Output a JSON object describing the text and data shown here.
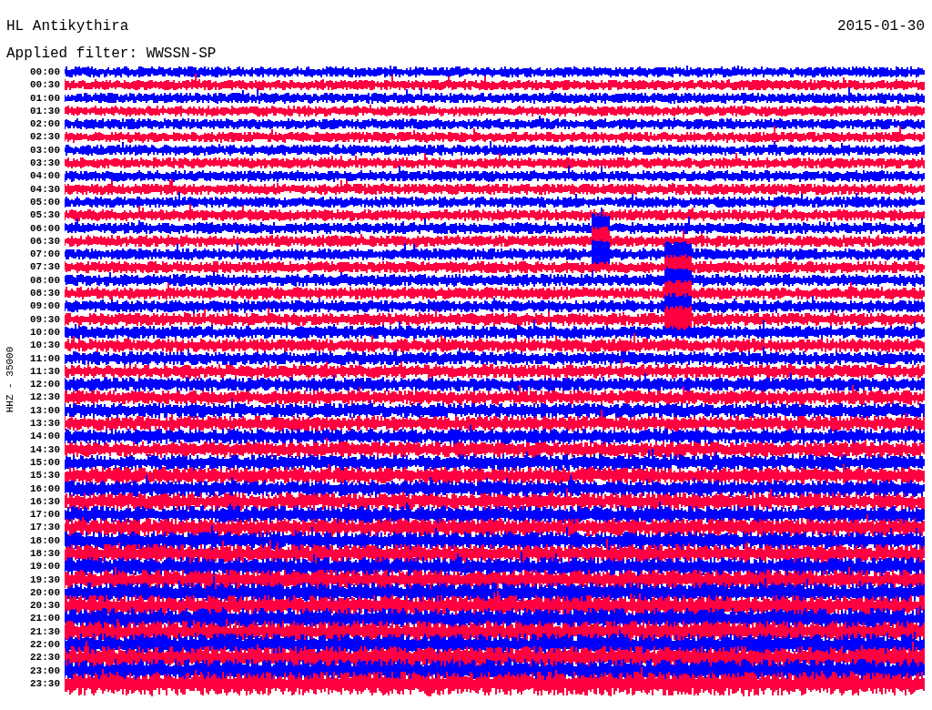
{
  "header": {
    "station": "HL Antikythira",
    "date": "2015-01-30",
    "filter": "Applied filter: WWSSN-SP"
  },
  "axis_label": "HHZ - 35000",
  "rows": [
    {
      "time": "00:00",
      "color": "#0000ff"
    },
    {
      "time": "00:30",
      "color": "#ff0040"
    },
    {
      "time": "01:00",
      "color": "#0000ff"
    },
    {
      "time": "01:30",
      "color": "#ff0040"
    },
    {
      "time": "02:00",
      "color": "#0000ff"
    },
    {
      "time": "02:30",
      "color": "#ff0040"
    },
    {
      "time": "03:00",
      "color": "#0000ff"
    },
    {
      "time": "03:30",
      "color": "#ff0040"
    },
    {
      "time": "04:00",
      "color": "#0000ff"
    },
    {
      "time": "04:30",
      "color": "#ff0040"
    },
    {
      "time": "05:00",
      "color": "#0000ff"
    },
    {
      "time": "05:30",
      "color": "#ff0040"
    },
    {
      "time": "06:00",
      "color": "#0000ff"
    },
    {
      "time": "06:30",
      "color": "#ff0040"
    },
    {
      "time": "07:00",
      "color": "#0000ff"
    },
    {
      "time": "07:30",
      "color": "#ff0040"
    },
    {
      "time": "08:00",
      "color": "#0000ff"
    },
    {
      "time": "08:30",
      "color": "#ff0040"
    },
    {
      "time": "09:00",
      "color": "#0000ff"
    },
    {
      "time": "09:30",
      "color": "#ff0040"
    },
    {
      "time": "10:00",
      "color": "#0000ff"
    },
    {
      "time": "10:30",
      "color": "#ff0040"
    },
    {
      "time": "11:00",
      "color": "#0000ff"
    },
    {
      "time": "11:30",
      "color": "#ff0040"
    },
    {
      "time": "12:00",
      "color": "#0000ff"
    },
    {
      "time": "12:30",
      "color": "#ff0040"
    },
    {
      "time": "13:00",
      "color": "#0000ff"
    },
    {
      "time": "13:30",
      "color": "#ff0040"
    },
    {
      "time": "14:00",
      "color": "#0000ff"
    },
    {
      "time": "14:30",
      "color": "#ff0040"
    },
    {
      "time": "15:00",
      "color": "#0000ff"
    },
    {
      "time": "15:30",
      "color": "#ff0040"
    },
    {
      "time": "16:00",
      "color": "#0000ff"
    },
    {
      "time": "16:30",
      "color": "#ff0040"
    },
    {
      "time": "17:00",
      "color": "#0000ff"
    },
    {
      "time": "17:30",
      "color": "#ff0040"
    },
    {
      "time": "18:00",
      "color": "#0000ff"
    },
    {
      "time": "18:30",
      "color": "#ff0040"
    },
    {
      "time": "19:00",
      "color": "#0000ff"
    },
    {
      "time": "19:30",
      "color": "#ff0040"
    },
    {
      "time": "20:00",
      "color": "#0000ff"
    },
    {
      "time": "20:30",
      "color": "#ff0040"
    },
    {
      "time": "21:00",
      "color": "#0000ff"
    },
    {
      "time": "21:30",
      "color": "#ff0040"
    },
    {
      "time": "22:00",
      "color": "#0000ff"
    },
    {
      "time": "22:30",
      "color": "#ff0040"
    },
    {
      "time": "23:00",
      "color": "#0000ff"
    },
    {
      "time": "23:30",
      "color": "#ff0040"
    }
  ]
}
